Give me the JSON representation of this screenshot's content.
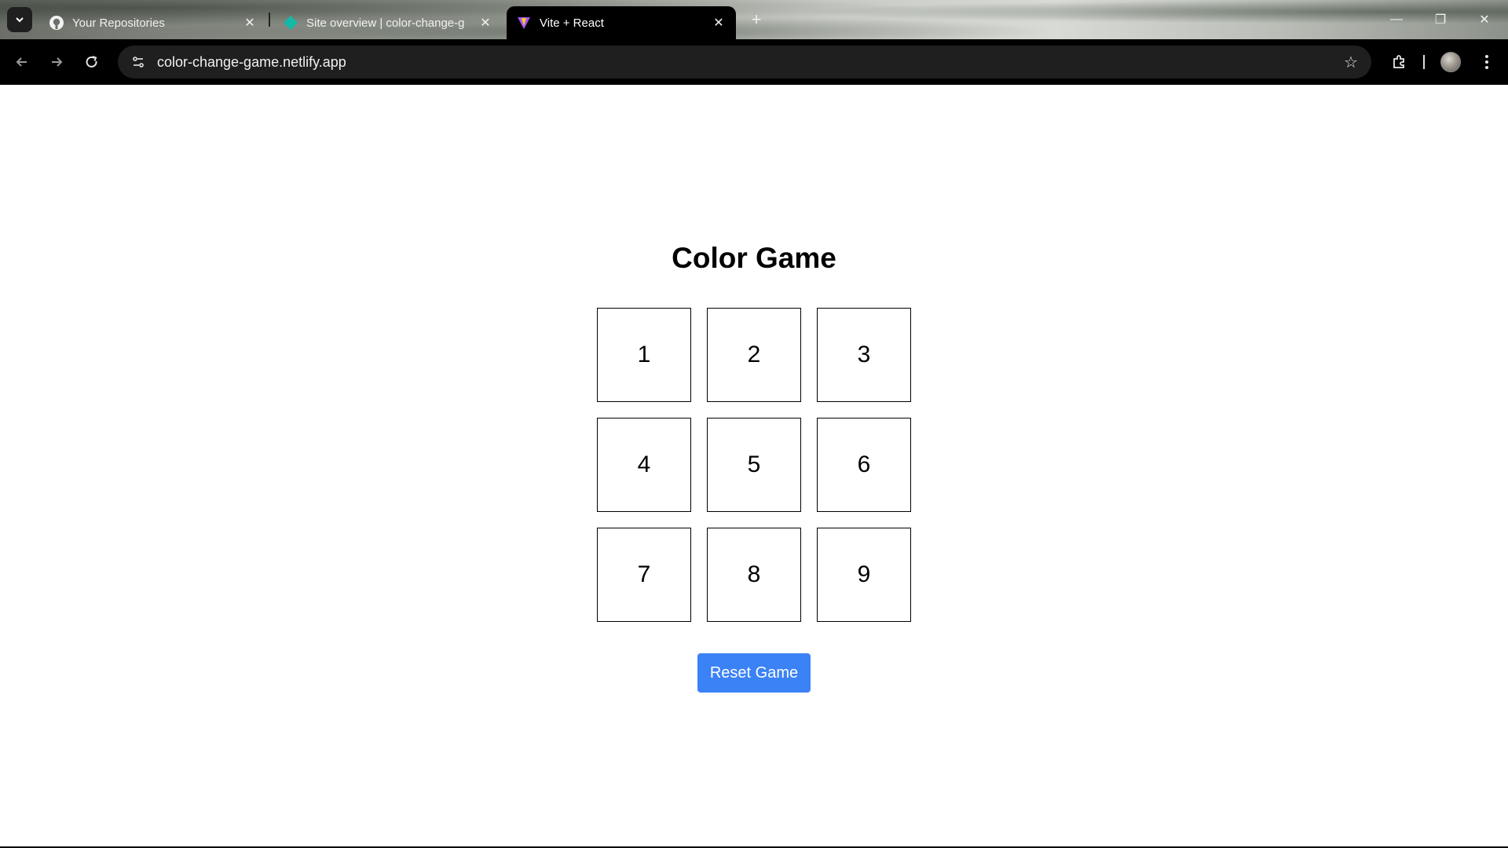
{
  "browser": {
    "tabs": [
      {
        "title": "Your Repositories",
        "favicon": "github-icon"
      },
      {
        "title": "Site overview | color-change-g",
        "favicon": "netlify-icon"
      },
      {
        "title": "Vite + React",
        "favicon": "vite-icon",
        "active": true
      }
    ],
    "new_tab": "+",
    "url": "color-change-game.netlify.app",
    "window_controls": {
      "minimize": "—",
      "maximize": "❐",
      "close": "✕"
    }
  },
  "game": {
    "title": "Color Game",
    "cells": [
      "1",
      "2",
      "3",
      "4",
      "5",
      "6",
      "7",
      "8",
      "9"
    ],
    "reset_label": "Reset Game"
  },
  "colors": {
    "accent": "#3b82f6",
    "tab_bg": "#000000",
    "omnibox_bg": "#1f1f1f"
  }
}
